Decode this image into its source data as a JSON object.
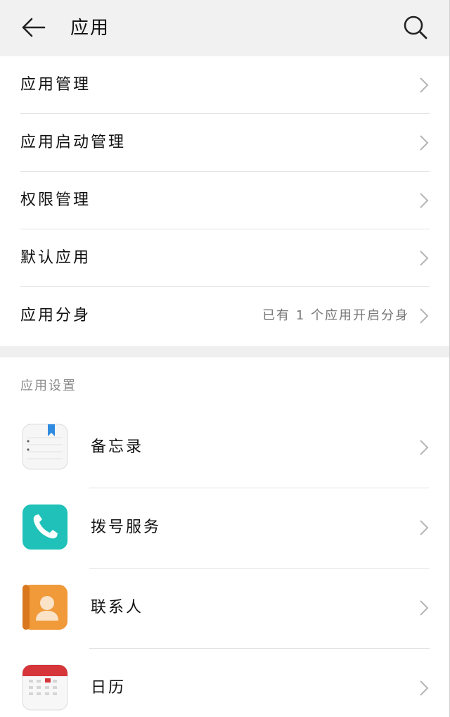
{
  "header": {
    "title": "应用"
  },
  "menu": {
    "items": [
      {
        "label": "应用管理",
        "value": ""
      },
      {
        "label": "应用启动管理",
        "value": ""
      },
      {
        "label": "权限管理",
        "value": ""
      },
      {
        "label": "默认应用",
        "value": ""
      },
      {
        "label": "应用分身",
        "value": "已有 1 个应用开启分身"
      }
    ]
  },
  "app_settings": {
    "section_title": "应用设置",
    "apps": [
      {
        "label": "备忘录",
        "icon": "notepad-icon"
      },
      {
        "label": "拨号服务",
        "icon": "phone-icon"
      },
      {
        "label": "联系人",
        "icon": "contacts-icon"
      },
      {
        "label": "日历",
        "icon": "calendar-icon"
      }
    ]
  },
  "colors": {
    "header_bg": "#f1f1f1",
    "phone_teal": "#1fc1b8",
    "contacts_orange": "#f09a3a",
    "calendar_red": "#d6353a",
    "notepad_blue": "#2f8be0"
  }
}
